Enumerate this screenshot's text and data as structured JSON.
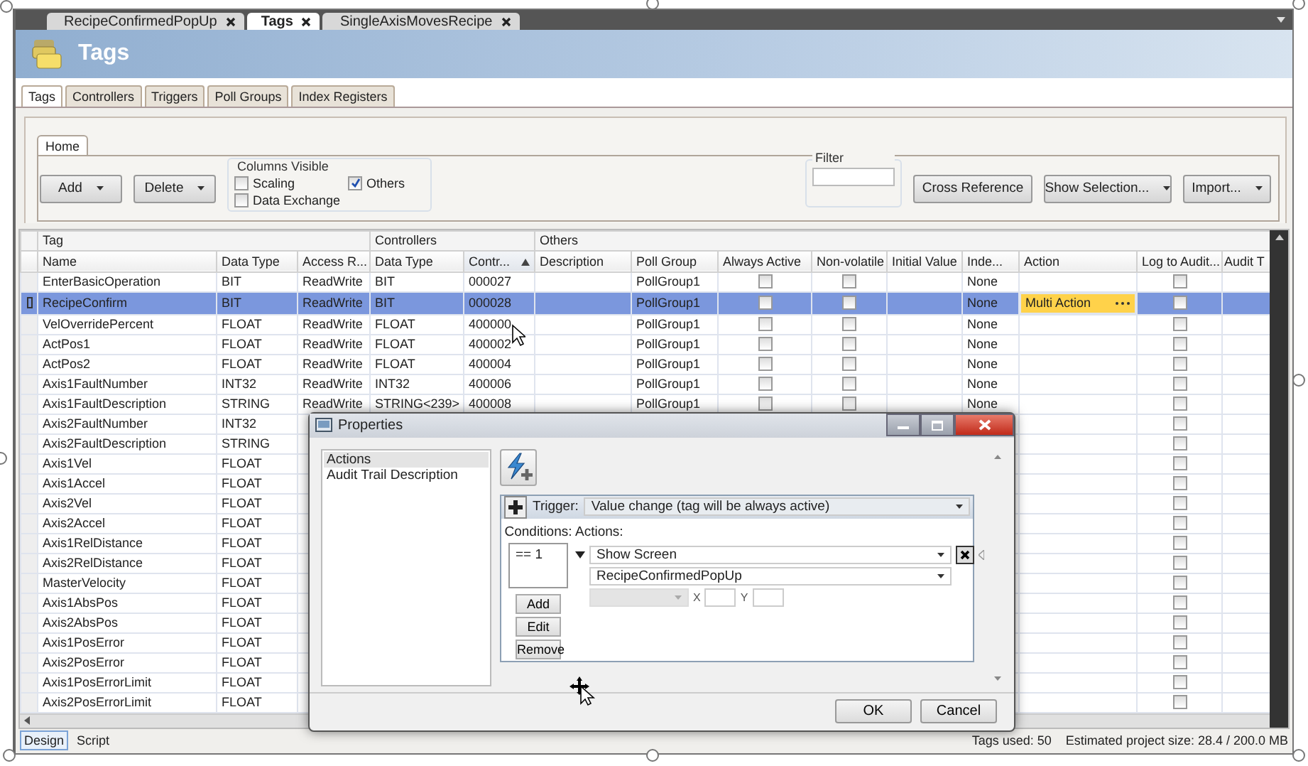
{
  "document_tabs": [
    {
      "label": "RecipeConfirmedPopUp",
      "selected": false
    },
    {
      "label": "Tags",
      "selected": true
    },
    {
      "label": "SingleAxisMovesRecipe",
      "selected": false
    }
  ],
  "header": {
    "title": "Tags"
  },
  "view_tabs": [
    {
      "label": "Tags",
      "selected": true
    },
    {
      "label": "Controllers",
      "selected": false
    },
    {
      "label": "Triggers",
      "selected": false
    },
    {
      "label": "Poll Groups",
      "selected": false
    },
    {
      "label": "Index Registers",
      "selected": false
    }
  ],
  "ribbon": {
    "tab": "Home",
    "buttons": [
      {
        "label": "Add",
        "dropdown": true
      },
      {
        "label": "Delete",
        "dropdown": true
      }
    ],
    "columns_visible": {
      "title": "Columns Visible",
      "options": [
        {
          "label": "Scaling",
          "checked": false
        },
        {
          "label": "Others",
          "checked": true
        },
        {
          "label": "Data Exchange",
          "checked": false
        }
      ]
    },
    "filter": {
      "label": "Filter"
    },
    "right_buttons": [
      {
        "label": "Cross Reference",
        "dropdown": false
      },
      {
        "label": "Show Selection...",
        "dropdown": true
      },
      {
        "label": "Import...",
        "dropdown": true
      }
    ]
  },
  "grid": {
    "column_groups": [
      {
        "label": "Tag",
        "columns": [
          {
            "label": "Name",
            "sorted": false
          },
          {
            "label": "Data Type",
            "sorted": false
          },
          {
            "label": "Access R...",
            "sorted": false
          }
        ]
      },
      {
        "label": "Controllers",
        "columns": [
          {
            "label": "Data Type",
            "sorted": false
          },
          {
            "label": "Contr...",
            "sorted": true
          }
        ]
      },
      {
        "label": "Others",
        "columns": [
          {
            "label": "Description",
            "sorted": false
          },
          {
            "label": "Poll Group",
            "sorted": false
          },
          {
            "label": "Always Active",
            "sorted": false
          },
          {
            "label": "Non-volatile",
            "sorted": false
          },
          {
            "label": "Initial Value",
            "sorted": false
          },
          {
            "label": "Inde...",
            "sorted": false
          },
          {
            "label": "Action",
            "sorted": false
          },
          {
            "label": "Log to Audit...",
            "sorted": false
          },
          {
            "label": "Audit T",
            "sorted": false
          }
        ]
      }
    ],
    "rows": [
      {
        "selected": false,
        "name": "EnterBasicOperation",
        "data_type": "BIT",
        "access": "ReadWrite",
        "ctrl_data_type": "BIT",
        "address": "000027",
        "poll_group": "PollGroup1",
        "always_active": false,
        "non_volatile": false,
        "index_register": "None",
        "log_to_audit": false
      },
      {
        "selected": true,
        "name": "RecipeConfirm",
        "data_type": "BIT",
        "access": "ReadWrite",
        "ctrl_data_type": "BIT",
        "address": "000028",
        "poll_group": "PollGroup1",
        "always_active": false,
        "non_volatile": false,
        "index_register": "None",
        "action": "Multi Action",
        "log_to_audit": false
      },
      {
        "selected": false,
        "name": "VelOverridePercent",
        "data_type": "FLOAT",
        "access": "ReadWrite",
        "ctrl_data_type": "FLOAT",
        "address": "400000",
        "poll_group": "PollGroup1",
        "always_active": false,
        "non_volatile": false,
        "index_register": "None",
        "log_to_audit": false
      },
      {
        "selected": false,
        "name": "ActPos1",
        "data_type": "FLOAT",
        "access": "ReadWrite",
        "ctrl_data_type": "FLOAT",
        "address": "400002",
        "poll_group": "PollGroup1",
        "always_active": false,
        "non_volatile": false,
        "index_register": "None",
        "log_to_audit": false
      },
      {
        "selected": false,
        "name": "ActPos2",
        "data_type": "FLOAT",
        "access": "ReadWrite",
        "ctrl_data_type": "FLOAT",
        "address": "400004",
        "poll_group": "PollGroup1",
        "always_active": false,
        "non_volatile": false,
        "index_register": "None",
        "log_to_audit": false
      },
      {
        "selected": false,
        "name": "Axis1FaultNumber",
        "data_type": "INT32",
        "access": "ReadWrite",
        "ctrl_data_type": "INT32",
        "address": "400006",
        "poll_group": "PollGroup1",
        "always_active": false,
        "non_volatile": false,
        "index_register": "None",
        "log_to_audit": false
      },
      {
        "selected": false,
        "name": "Axis1FaultDescription",
        "data_type": "STRING",
        "access": "ReadWrite",
        "ctrl_data_type": "STRING<239>",
        "address": "400008",
        "poll_group": "PollGroup1",
        "always_active": false,
        "non_volatile": false,
        "index_register": "None",
        "log_to_audit": false
      },
      {
        "selected": false,
        "name": "Axis2FaultNumber",
        "data_type": "INT32",
        "log_to_audit": false
      },
      {
        "selected": false,
        "name": "Axis2FaultDescription",
        "data_type": "STRING",
        "log_to_audit": false
      },
      {
        "selected": false,
        "name": "Axis1Vel",
        "data_type": "FLOAT",
        "log_to_audit": false
      },
      {
        "selected": false,
        "name": "Axis1Accel",
        "data_type": "FLOAT",
        "log_to_audit": false
      },
      {
        "selected": false,
        "name": "Axis2Vel",
        "data_type": "FLOAT",
        "log_to_audit": false
      },
      {
        "selected": false,
        "name": "Axis2Accel",
        "data_type": "FLOAT",
        "log_to_audit": false
      },
      {
        "selected": false,
        "name": "Axis1RelDistance",
        "data_type": "FLOAT",
        "log_to_audit": false
      },
      {
        "selected": false,
        "name": "Axis2RelDistance",
        "data_type": "FLOAT",
        "log_to_audit": false
      },
      {
        "selected": false,
        "name": "MasterVelocity",
        "data_type": "FLOAT",
        "log_to_audit": false
      },
      {
        "selected": false,
        "name": "Axis1AbsPos",
        "data_type": "FLOAT",
        "log_to_audit": false
      },
      {
        "selected": false,
        "name": "Axis2AbsPos",
        "data_type": "FLOAT",
        "log_to_audit": false
      },
      {
        "selected": false,
        "name": "Axis1PosError",
        "data_type": "FLOAT",
        "log_to_audit": false
      },
      {
        "selected": false,
        "name": "Axis2PosError",
        "data_type": "FLOAT",
        "log_to_audit": false
      },
      {
        "selected": false,
        "name": "Axis1PosErrorLimit",
        "data_type": "FLOAT",
        "log_to_audit": false
      },
      {
        "selected": false,
        "name": "Axis2PosErrorLimit",
        "data_type": "FLOAT",
        "log_to_audit": false
      }
    ]
  },
  "dialog": {
    "title": "Properties",
    "categories": [
      {
        "label": "Actions",
        "selected": true
      },
      {
        "label": "Audit Trail Description",
        "selected": false
      }
    ],
    "trigger_label": "Trigger:",
    "trigger": "Value change (tag will be always active)",
    "conditions_label": "Conditions:",
    "actions_label": "Actions:",
    "conditions": [
      "== 1"
    ],
    "condition_buttons": [
      "Add",
      "Edit",
      "Remove"
    ],
    "action": {
      "type": "Show Screen",
      "screen": "RecipeConfirmedPopUp",
      "x_label": "X",
      "y_label": "Y"
    },
    "buttons": [
      "OK",
      "Cancel"
    ]
  },
  "status_bar": {
    "tabs": [
      {
        "label": "Design",
        "selected": true
      },
      {
        "label": "Script",
        "selected": false
      }
    ],
    "tags_used": "Tags used: 50",
    "project_size": "Estimated project size: 28.4 / 200.0 MB"
  }
}
